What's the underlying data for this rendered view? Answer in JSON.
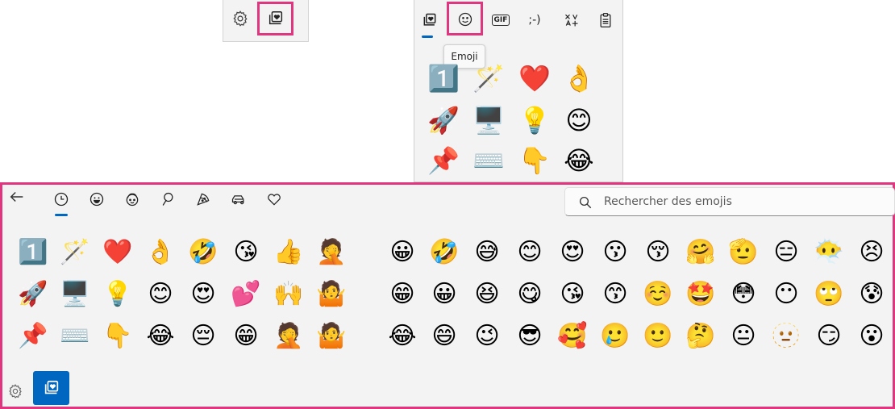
{
  "mini_toolbar": {
    "settings_icon": "gear-icon",
    "favorites_icon": "heart-card-icon",
    "highlight_color": "#e0357f"
  },
  "top_panel": {
    "tabs": [
      {
        "id": "favorites",
        "icon": "heart-card-icon"
      },
      {
        "id": "emoji",
        "icon": "smiley-icon"
      },
      {
        "id": "gif",
        "label": "GIF"
      },
      {
        "id": "kaomoji",
        "label": ";-)"
      },
      {
        "id": "symbols",
        "icon": "symbols-icon"
      },
      {
        "id": "clipboard",
        "icon": "clipboard-icon"
      }
    ],
    "tooltip": "Emoji",
    "emojis": [
      "1️⃣",
      "🪄",
      "❤️",
      "👌",
      "🚀",
      "🖥️",
      "💡",
      "😊",
      "📌",
      "⌨️",
      "👇",
      "😂"
    ]
  },
  "main_panel": {
    "back_icon": "back-arrow-icon",
    "category_tabs": [
      {
        "id": "recent",
        "icon": "clock-icon"
      },
      {
        "id": "smileys",
        "icon": "smiley-icon"
      },
      {
        "id": "people",
        "icon": "face-icon"
      },
      {
        "id": "nature",
        "icon": "leaf-icon"
      },
      {
        "id": "food",
        "icon": "pizza-icon"
      },
      {
        "id": "travel",
        "icon": "car-icon"
      },
      {
        "id": "symbols",
        "icon": "heart-outline-icon"
      }
    ],
    "search": {
      "placeholder": "Rechercher des emojis"
    },
    "recent_emojis": [
      "1️⃣",
      "🪄",
      "❤️",
      "👌",
      "🤣",
      "😘",
      "👍",
      "🤦",
      "🚀",
      "🖥️",
      "💡",
      "😊",
      "😍",
      "💕",
      "🙌",
      "🤷",
      "📌",
      "⌨️",
      "👇",
      "😂",
      "😔",
      "😁",
      "🤦",
      "🤷"
    ],
    "smiley_emojis": [
      "😀",
      "🤣",
      "😅",
      "😊",
      "😍",
      "😗",
      "😚",
      "🤗",
      "🫡",
      "😑",
      "😶‍🌫️",
      "😣",
      "😁",
      "😀",
      "😆",
      "😋",
      "😘",
      "😙",
      "☺️",
      "🤩",
      "😳",
      "😶",
      "🙄",
      "😰",
      "😂",
      "😄",
      "😉",
      "😎",
      "🥰",
      "🥲",
      "🙂",
      "🤔",
      "😐",
      "🫥",
      "😏",
      "😮"
    ],
    "bottom_settings_icon": "gear-icon",
    "bottom_favorites_icon": "heart-card-icon",
    "accent_color": "#0067c0"
  }
}
